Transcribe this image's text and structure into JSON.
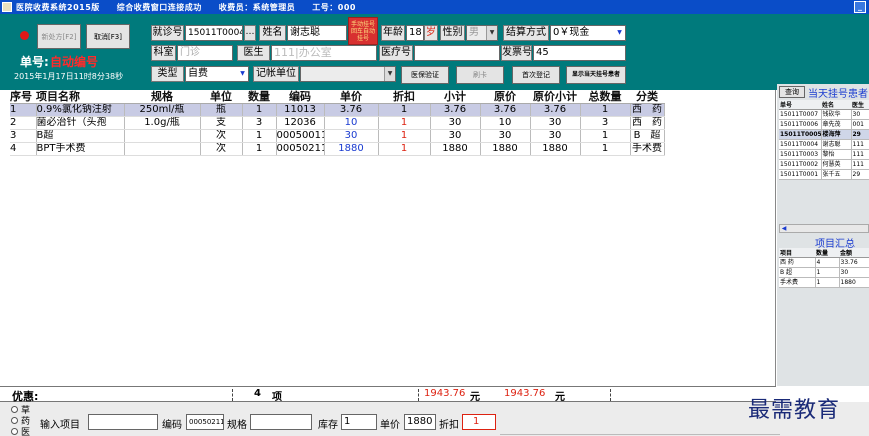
{
  "window": {
    "title": "医院收费系统2015版　　综合收费窗口连接成功　　收费员：系统管理员　　工号：000"
  },
  "toolbar": {
    "new_rx_label": "新处方[F2]",
    "cancel_label": "取消[F3]"
  },
  "patient_status": {
    "serial_label": "单号:",
    "serial_value": "自动编号",
    "datetime": "2015年1月17日11时8分38秒"
  },
  "form": {
    "visit_no_label": "就诊号",
    "visit_no_value": "15011T0004",
    "name_label": "姓名",
    "name_value": "谢志聪",
    "reg_button_label": "手动挂号 回车自动挂号",
    "age_label": "年龄",
    "age_value": "18",
    "age_unit": "岁",
    "gender_label": "性别",
    "gender_value": "男",
    "settlement_label": "结算方式",
    "settlement_value": "0￥现金",
    "dept_label": "科室",
    "dept_value": "门诊",
    "doctor_label": "医生",
    "doctor_value": "111|办公室",
    "insurance_label": "医疗号",
    "insurance_value": "",
    "invoice_label": "发票号",
    "invoice_value": "45",
    "type_label": "类型",
    "type_value": "自费",
    "account_label": "记帐单位",
    "account_value": "",
    "insurance_verify_label": "医保验证",
    "card_label": "刷卡",
    "first_reg_label": "首次登记",
    "show_today_label": "显示当天挂号患者"
  },
  "grid": {
    "columns": [
      "序号",
      "项目名称",
      "规格",
      "单位",
      "数量",
      "编码",
      "单价",
      "折扣",
      "小计",
      "原价",
      "原价小计",
      "总数量",
      "分类"
    ],
    "rows": [
      {
        "no": "1",
        "name": "0.9%氯化钠注射",
        "spec": "250ml/瓶",
        "unit": "瓶",
        "qty": "1",
        "code": "11013",
        "price": "3.76",
        "discount": "1",
        "subtotal": "3.76",
        "orig_price": "3.76",
        "orig_subtotal": "3.76",
        "total_qty": "1",
        "category": "西　药"
      },
      {
        "no": "2",
        "name": "菌必治针（头孢",
        "spec": "1.0g/瓶",
        "unit": "支",
        "qty": "3",
        "code": "12036",
        "price": "10",
        "discount": "1",
        "subtotal": "30",
        "orig_price": "10",
        "orig_subtotal": "30",
        "total_qty": "3",
        "category": "西　药"
      },
      {
        "no": "3",
        "name": "B超",
        "spec": "",
        "unit": "次",
        "qty": "1",
        "code": "00050011",
        "price": "30",
        "discount": "1",
        "subtotal": "30",
        "orig_price": "30",
        "orig_subtotal": "30",
        "total_qty": "1",
        "category": "B　超"
      },
      {
        "no": "4",
        "name": "BPT手术费",
        "spec": "",
        "unit": "次",
        "qty": "1",
        "code": "00050211",
        "price": "1880",
        "discount": "1",
        "subtotal": "1880",
        "orig_price": "1880",
        "orig_subtotal": "1880",
        "total_qty": "1",
        "category": "手术费"
      }
    ]
  },
  "right_panel": {
    "query_label": "查询",
    "today_label": "当天挂号患者",
    "patient_cols": [
      "单号",
      "姓名",
      "医生"
    ],
    "patients": [
      {
        "id": "15011T0007",
        "name": "钱砍华",
        "doc": "30"
      },
      {
        "id": "15011T0006",
        "name": "章先茂",
        "doc": "001"
      },
      {
        "id": "15011T0005",
        "name": "楼海萍",
        "doc": "29"
      },
      {
        "id": "15011T0004",
        "name": "谢志聪",
        "doc": "111"
      },
      {
        "id": "15011T0003",
        "name": "黎怡",
        "doc": "111"
      },
      {
        "id": "15011T0002",
        "name": "何慧英",
        "doc": "111"
      },
      {
        "id": "15011T0001",
        "name": "张千五",
        "doc": "29"
      }
    ],
    "summary_title": "项目汇总",
    "summary_cols": [
      "项目",
      "数量",
      "金额"
    ],
    "summary_rows": [
      {
        "item": "西 药",
        "qty": "4",
        "amount": "33.76"
      },
      {
        "item": "B 超",
        "qty": "1",
        "amount": "30"
      },
      {
        "item": "手术费",
        "qty": "1",
        "amount": "1880"
      }
    ]
  },
  "summary": {
    "discount_label": "优惠:",
    "count": "4",
    "count_unit": "项",
    "total": "1943.76",
    "total_unit": "元",
    "orig_total": "1943.76",
    "orig_unit": "元"
  },
  "bottom": {
    "radio_labels": [
      "草",
      "药",
      "医"
    ],
    "input_item_label": "输入项目",
    "input_item_value": "",
    "code_label": "编码",
    "code_value": "00050211",
    "spec_label": "规格",
    "spec_value": "",
    "stock_label": "库存",
    "stock_value": "1",
    "price_label": "单价",
    "price_value": "1880",
    "discount_label": "折扣",
    "discount_value": "1"
  },
  "watermark": "最需教育"
}
